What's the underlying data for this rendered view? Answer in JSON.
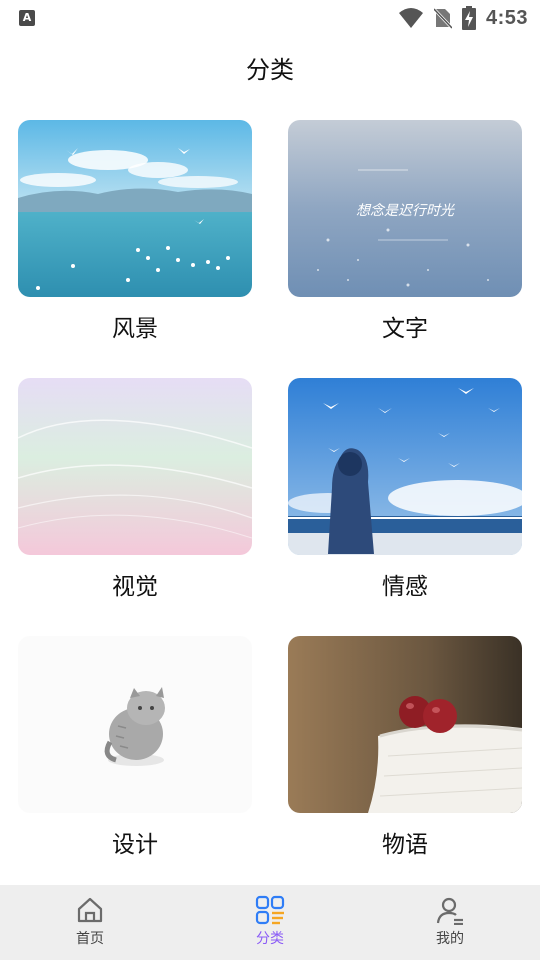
{
  "status_bar": {
    "app_icon_letter": "A",
    "time": "4:53"
  },
  "header": {
    "title": "分类"
  },
  "categories": [
    {
      "label": "风景",
      "thumb_text": ""
    },
    {
      "label": "文字",
      "thumb_text": "想念是迟行时光"
    },
    {
      "label": "视觉",
      "thumb_text": ""
    },
    {
      "label": "情感",
      "thumb_text": ""
    },
    {
      "label": "设计",
      "thumb_text": ""
    },
    {
      "label": "物语",
      "thumb_text": ""
    }
  ],
  "tabbar": {
    "tabs": [
      {
        "label": "首页",
        "icon": "home-icon"
      },
      {
        "label": "分类",
        "icon": "category-grid-icon"
      },
      {
        "label": "我的",
        "icon": "user-icon"
      }
    ],
    "active_index": 1
  },
  "colors": {
    "accent": "#8b5cf6",
    "tabbar_bg": "#eeeeee",
    "category_icon_blue": "#2f7df6",
    "category_icon_orange": "#f5a623"
  }
}
